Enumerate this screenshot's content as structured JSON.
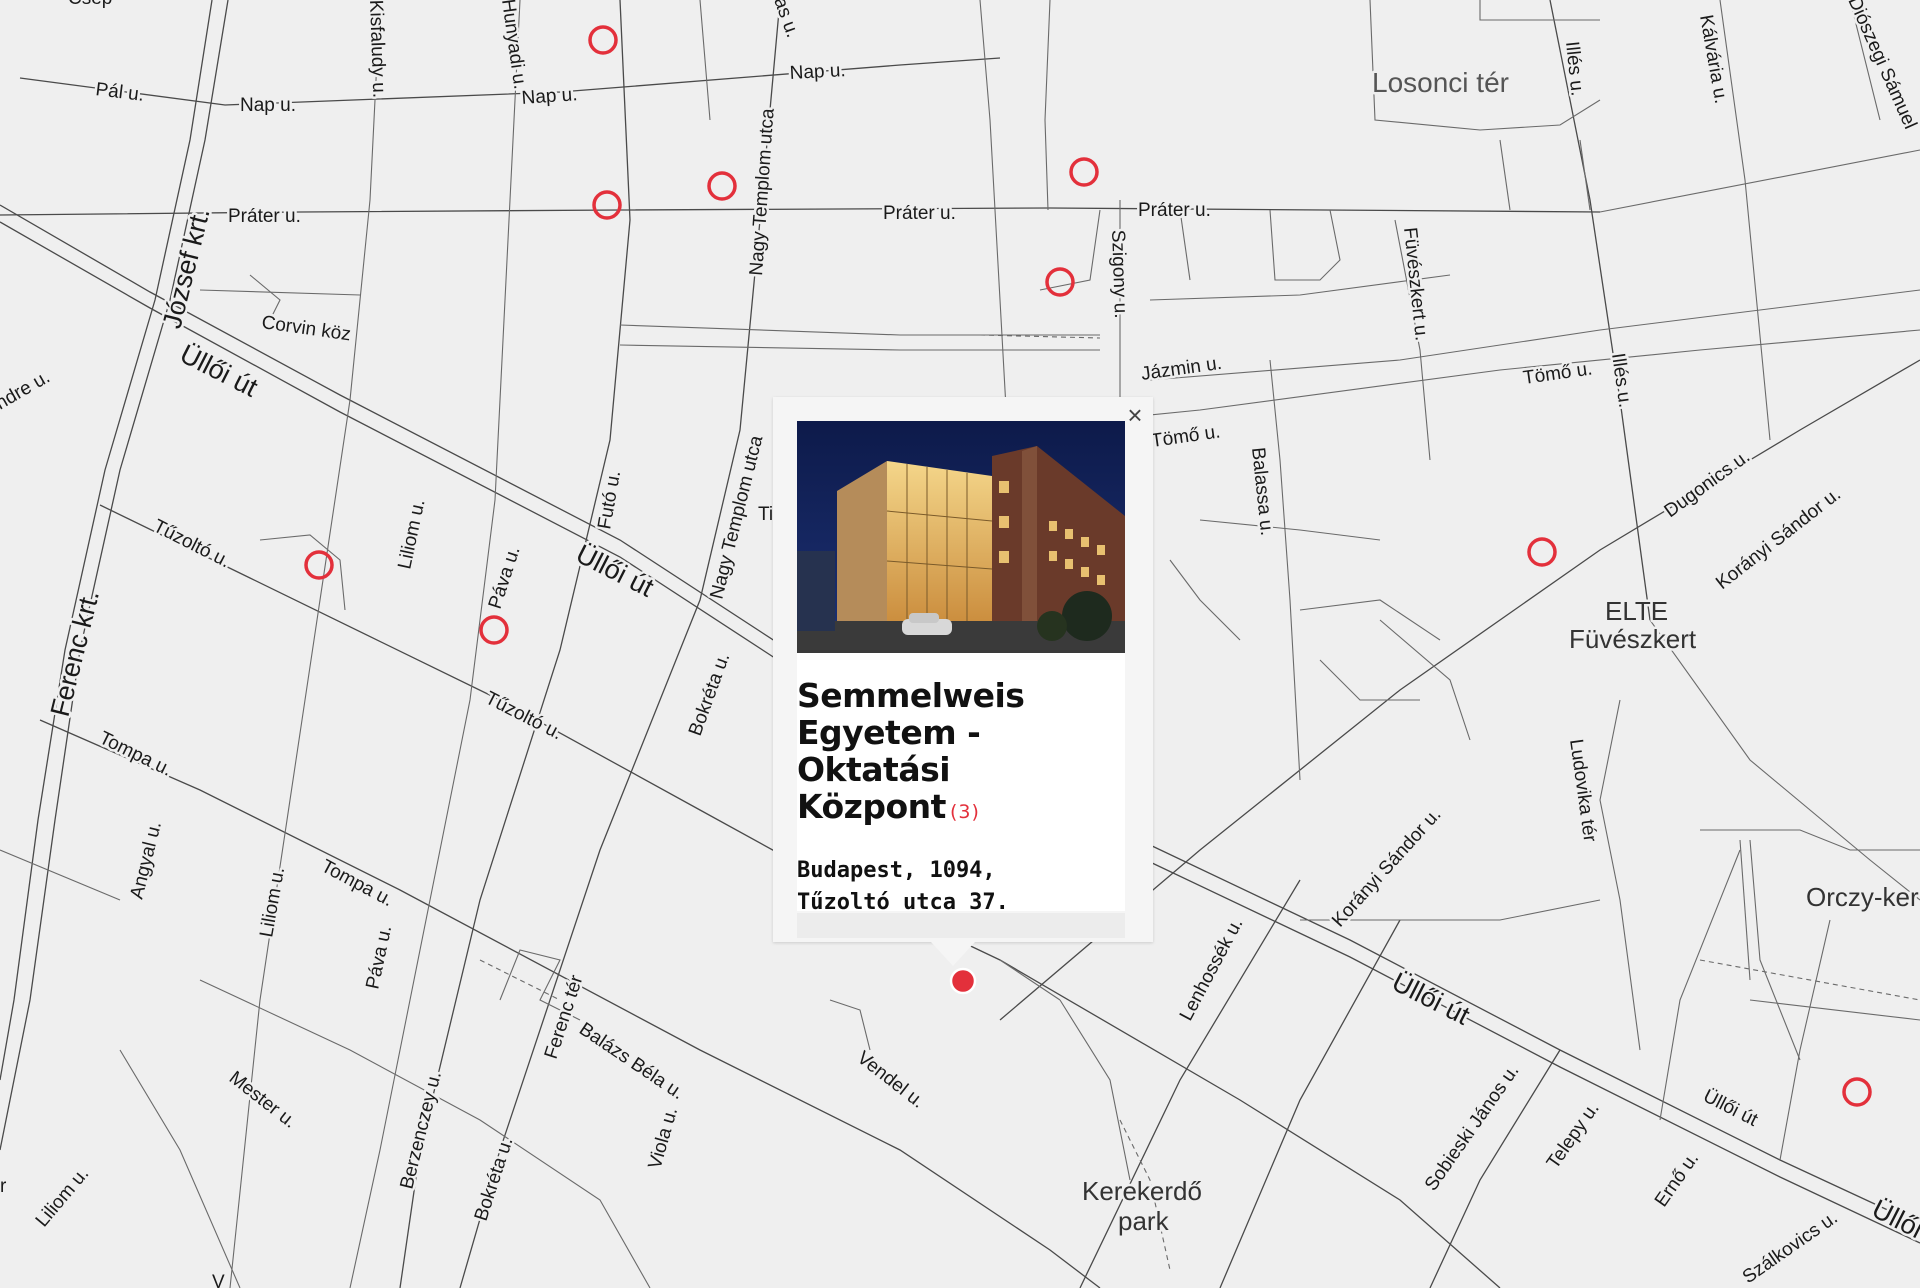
{
  "map": {
    "places": {
      "losonci_ter": "Losonci tér",
      "elte_line1": "ELTE",
      "elte_line2": "Füvészkert",
      "orczy": "Orczy-ker",
      "kerekerdo_line1": "Kerekerdő",
      "kerekerdo_line2": "park"
    },
    "streets": {
      "csep": "Csep",
      "pal": "Pál u.",
      "nap1": "Nap u.",
      "nap2": "Nap u.",
      "nap3": "Nap u.",
      "prater1": "Práter u.",
      "prater2": "Práter u.",
      "prater3": "Práter u.",
      "jozsef": "József krt.",
      "corvin": "Corvin köz",
      "ulloi1": "Üllői út",
      "ulloi2": "Üllői út",
      "ulloi3": "Üllői út",
      "ulloi4": "Üllői út",
      "ulloi5": "Üllői",
      "ferenc_krt": "Ferenc krt.",
      "tuzolto1": "Tűzoltó u.",
      "tuzolto2": "Tűzoltó u.",
      "liliom1": "Liliom u.",
      "liliom2": "Liliom u.",
      "liliom3": "Liliom u.",
      "pava1": "Páva u.",
      "pava2": "Páva u.",
      "futo": "Futó u.",
      "nagy_templom1": "Nagy Templom utca",
      "nagy_templom2": "Nagy Templom utca",
      "bokreta1": "Bokréta u.",
      "bokreta2": "Bokréta u.",
      "tompa1": "Tompa u.",
      "tompa2": "Tompa u.",
      "angyal": "Angyal u.",
      "mester": "Mester u.",
      "berzenczey": "Berzenczey u.",
      "ferenc_ter": "Ferenc tér",
      "balazs_bela": "Balázs Béla u.",
      "viola": "Viola u.",
      "vendel": "Vendel u.",
      "szigony": "Szigony u.",
      "jazmin": "Jázmin u.",
      "tomo1": "Tömő u.",
      "tomo2": "Tömő u.",
      "balassa": "Balassa u.",
      "fuveszkert": "Füvészkert u.",
      "illes1": "Illés u.",
      "illes2": "Illés u.",
      "kalvaria": "Kálvária u.",
      "dioszegi": "Diószegi Sámuel",
      "dugonics": "Dugonics u.",
      "koranyi1": "Korányi Sándor u.",
      "koranyi2": "Korányi Sándor u.",
      "ludovika": "Ludovika tér",
      "lenhossek": "Lenhossék u.",
      "sobieski": "Sobieski János u.",
      "telepy": "Telepy u.",
      "erno": "Ernő u.",
      "szalkovics": "Szálkovics u.",
      "kisfaludy": "Kisfaludy u.",
      "hunyadi": "Hunyadi u.",
      "mas": "as u.",
      "vandre": "ndre u.",
      "ti": "Ti",
      "v": "V",
      "r": "r"
    },
    "markers": [
      {
        "id": "m1",
        "state": "normal"
      },
      {
        "id": "m2",
        "state": "normal"
      },
      {
        "id": "m3",
        "state": "normal"
      },
      {
        "id": "m4",
        "state": "normal"
      },
      {
        "id": "m5",
        "state": "normal"
      },
      {
        "id": "m6",
        "state": "normal"
      },
      {
        "id": "m7",
        "state": "normal"
      },
      {
        "id": "m8",
        "state": "normal"
      },
      {
        "id": "m9",
        "state": "normal"
      },
      {
        "id": "m10",
        "state": "normal"
      },
      {
        "id": "selected",
        "state": "active"
      }
    ],
    "colors": {
      "marker": "#e3303b",
      "background": "#efefef",
      "road": "#4a4a4a"
    }
  },
  "popup": {
    "close_icon": "×",
    "title": "Semmelweis Egyetem - Oktatási Központ",
    "count": "(3)",
    "address_line1": "Budapest, 1094,",
    "address_line2": "Tűzoltó utca 37.",
    "image": "night-photo-of-modern-glass-building"
  }
}
